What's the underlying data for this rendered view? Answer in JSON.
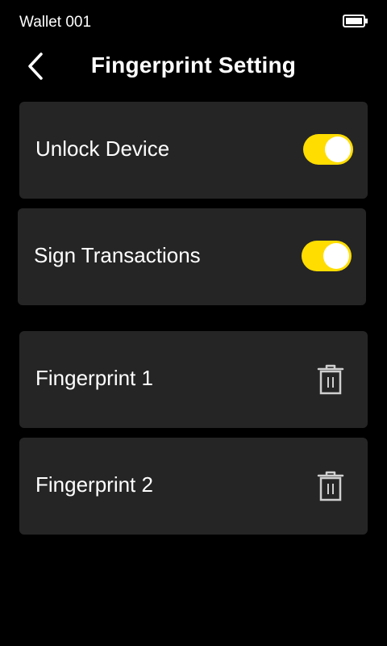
{
  "status_bar": {
    "wallet_name": "Wallet 001",
    "battery_icon": "battery-icon"
  },
  "header": {
    "back_icon": "chevron-left-icon",
    "title": "Fingerprint Setting"
  },
  "settings": [
    {
      "label": "Unlock Device",
      "enabled": true
    },
    {
      "label": "Sign Transactions",
      "enabled": true
    }
  ],
  "fingerprints": [
    {
      "label": "Fingerprint 1",
      "action_icon": "trash-icon"
    },
    {
      "label": "Fingerprint 2",
      "action_icon": "trash-icon"
    }
  ],
  "colors": {
    "background": "#000000",
    "card": "#252525",
    "accent": "#ffdd00",
    "text": "#ffffff",
    "icon": "#cfcfcf"
  }
}
